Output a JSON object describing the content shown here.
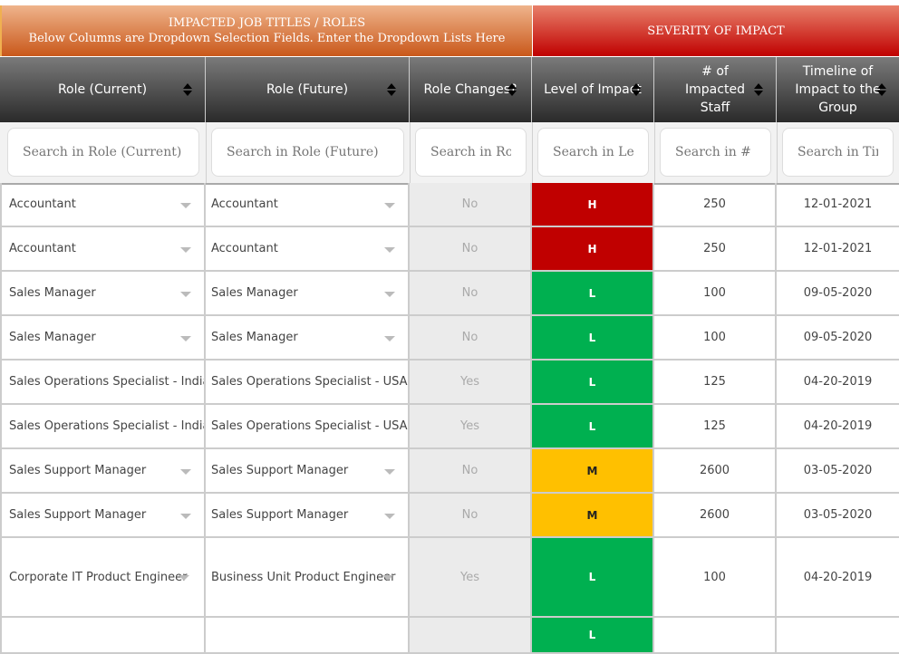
{
  "groups": {
    "impacted_title": "IMPACTED JOB TITLES / ROLES",
    "impacted_subtitle": "Below Columns are Dropdown Selection Fields. Enter the Dropdown Lists Here",
    "severity_title": "SEVERITY OF IMPACT"
  },
  "columns": [
    {
      "label": "Role (Current)",
      "placeholder": "Search in Role (Current)"
    },
    {
      "label": "Role (Future)",
      "placeholder": "Search in Role (Future)"
    },
    {
      "label": "Role Changes?",
      "placeholder": "Search in Role Changes?"
    },
    {
      "label": "Level of Impact",
      "placeholder": "Search in Level of Impact"
    },
    {
      "label": "# of Impacted Staff",
      "placeholder": "Search in # of Impacted Staff"
    },
    {
      "label": "Timeline of Impact to the Group",
      "placeholder": "Search in Timeline of Impact to the Group"
    }
  ],
  "colors": {
    "high": "#c00000",
    "medium": "#ffc000",
    "low": "#00b050"
  },
  "rows": [
    {
      "current": "Accountant",
      "future": "Accountant",
      "changes": "No",
      "level": "H",
      "staff": "250",
      "timeline": "12-01-2021"
    },
    {
      "current": "Accountant",
      "future": "Accountant",
      "changes": "No",
      "level": "H",
      "staff": "250",
      "timeline": "12-01-2021"
    },
    {
      "current": "Sales Manager",
      "future": "Sales Manager",
      "changes": "No",
      "level": "L",
      "staff": "100",
      "timeline": "09-05-2020"
    },
    {
      "current": "Sales Manager",
      "future": "Sales Manager",
      "changes": "No",
      "level": "L",
      "staff": "100",
      "timeline": "09-05-2020"
    },
    {
      "current": "Sales Operations Specialist - India",
      "future": "Sales Operations Specialist - USA",
      "changes": "Yes",
      "level": "L",
      "staff": "125",
      "timeline": "04-20-2019"
    },
    {
      "current": "Sales Operations Specialist - India",
      "future": "Sales Operations Specialist - USA",
      "changes": "Yes",
      "level": "L",
      "staff": "125",
      "timeline": "04-20-2019"
    },
    {
      "current": "Sales Support Manager",
      "future": "Sales Support Manager",
      "changes": "No",
      "level": "M",
      "staff": "2600",
      "timeline": "03-05-2020"
    },
    {
      "current": "Sales Support Manager",
      "future": "Sales Support Manager",
      "changes": "No",
      "level": "M",
      "staff": "2600",
      "timeline": "03-05-2020"
    },
    {
      "current": "Corporate IT Product Engineer",
      "future": "Business Unit Product Engineer",
      "changes": "Yes",
      "level": "L",
      "staff": "100",
      "timeline": "04-20-2019"
    },
    {
      "current": "",
      "future": "",
      "changes": "",
      "level": "L",
      "staff": "",
      "timeline": ""
    }
  ]
}
